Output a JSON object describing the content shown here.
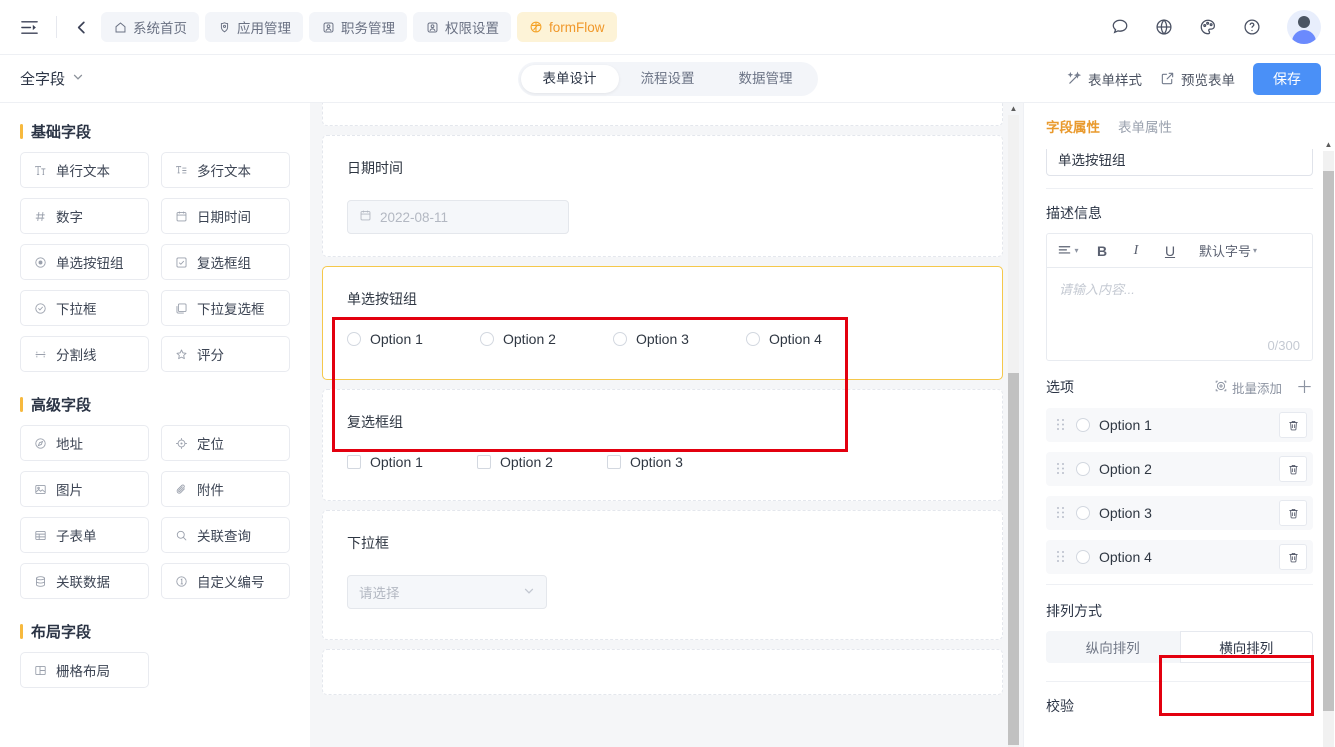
{
  "header": {
    "menu_icon": "sidebar-toggle-icon",
    "back_icon": "chevron-left-icon",
    "tabs": [
      {
        "label": "系统首页",
        "icon": "home-icon",
        "active": false
      },
      {
        "label": "应用管理",
        "icon": "apps-icon",
        "active": false
      },
      {
        "label": "职务管理",
        "icon": "user-square-icon",
        "active": false
      },
      {
        "label": "权限设置",
        "icon": "user-square-icon",
        "active": false
      },
      {
        "label": "formFlow",
        "icon": "flow-circle-icon",
        "active": true
      }
    ],
    "right_icons": [
      "message-icon",
      "globe-icon",
      "palette-icon",
      "help-icon"
    ],
    "avatar": "user-avatar"
  },
  "subheader": {
    "form_name": "全字段",
    "dropdown_icon": "chevron-down-icon",
    "segments": [
      {
        "label": "表单设计",
        "active": true
      },
      {
        "label": "流程设置",
        "active": false
      },
      {
        "label": "数据管理",
        "active": false
      }
    ],
    "form_style_label": "表单样式",
    "form_style_icon": "magic-wand-icon",
    "preview_label": "预览表单",
    "preview_icon": "external-link-icon",
    "save_label": "保存",
    "save_color": "#4a90f7"
  },
  "palette": {
    "groups": [
      {
        "title": "基础字段",
        "items": [
          {
            "label": "单行文本",
            "icon": "text-single-icon"
          },
          {
            "label": "多行文本",
            "icon": "text-multi-icon"
          },
          {
            "label": "数字",
            "icon": "hash-icon"
          },
          {
            "label": "日期时间",
            "icon": "calendar-icon"
          },
          {
            "label": "单选按钮组",
            "icon": "radio-icon"
          },
          {
            "label": "复选框组",
            "icon": "checkbox-icon"
          },
          {
            "label": "下拉框",
            "icon": "select-icon"
          },
          {
            "label": "下拉复选框",
            "icon": "multi-select-icon"
          },
          {
            "label": "分割线",
            "icon": "divider-icon"
          },
          {
            "label": "评分",
            "icon": "star-icon"
          }
        ]
      },
      {
        "title": "高级字段",
        "items": [
          {
            "label": "地址",
            "icon": "address-icon"
          },
          {
            "label": "定位",
            "icon": "location-icon"
          },
          {
            "label": "图片",
            "icon": "image-icon"
          },
          {
            "label": "附件",
            "icon": "paperclip-icon"
          },
          {
            "label": "子表单",
            "icon": "table-icon"
          },
          {
            "label": "关联查询",
            "icon": "search-icon"
          },
          {
            "label": "关联数据",
            "icon": "database-icon"
          },
          {
            "label": "自定义编号",
            "icon": "number-circle-icon"
          }
        ]
      },
      {
        "title": "布局字段",
        "items": [
          {
            "label": "栅格布局",
            "icon": "grid-layout-icon"
          }
        ]
      }
    ]
  },
  "canvas": {
    "fields": [
      {
        "type": "textarea",
        "label": "",
        "selected": false
      },
      {
        "type": "date",
        "label": "日期时间",
        "placeholder": "2022-08-11",
        "icon": "calendar-icon",
        "selected": false
      },
      {
        "type": "radio-group",
        "label": "单选按钮组",
        "selected": true,
        "options": [
          "Option 1",
          "Option 2",
          "Option 3",
          "Option 4"
        ]
      },
      {
        "type": "checkbox-group",
        "label": "复选框组",
        "selected": false,
        "options": [
          "Option 1",
          "Option 2",
          "Option 3"
        ]
      },
      {
        "type": "select",
        "label": "下拉框",
        "placeholder": "请选择",
        "selected": false
      }
    ]
  },
  "properties": {
    "tabs": [
      {
        "label": "字段属性",
        "active": true
      },
      {
        "label": "表单属性",
        "active": false
      }
    ],
    "field_name_value": "单选按钮组",
    "description_label": "描述信息",
    "editor": {
      "align_icon": "align-left-icon",
      "bold_label": "B",
      "italic_label": "I",
      "underline_label": "U",
      "fontsize_label": "默认字号",
      "placeholder": "请输入内容...",
      "counter": "0/300"
    },
    "options_label": "选项",
    "batch_add_label": "批量添加",
    "batch_add_icon": "batch-add-icon",
    "add_icon": "plus-icon",
    "options": [
      {
        "label": "Option 1",
        "drag_icon": "drag-handle-icon",
        "delete_icon": "trash-icon"
      },
      {
        "label": "Option 2",
        "drag_icon": "drag-handle-icon",
        "delete_icon": "trash-icon"
      },
      {
        "label": "Option 3",
        "drag_icon": "drag-handle-icon",
        "delete_icon": "trash-icon"
      },
      {
        "label": "Option 4",
        "drag_icon": "drag-handle-icon",
        "delete_icon": "trash-icon"
      }
    ],
    "layout_label": "排列方式",
    "layout_options": [
      {
        "label": "纵向排列",
        "active": false
      },
      {
        "label": "横向排列",
        "active": true
      }
    ],
    "validation_label": "校验"
  },
  "annotations": {
    "color": "#e3000f",
    "boxes": [
      "radio-group-card-highlight",
      "horizontal-layout-button-highlight"
    ]
  }
}
